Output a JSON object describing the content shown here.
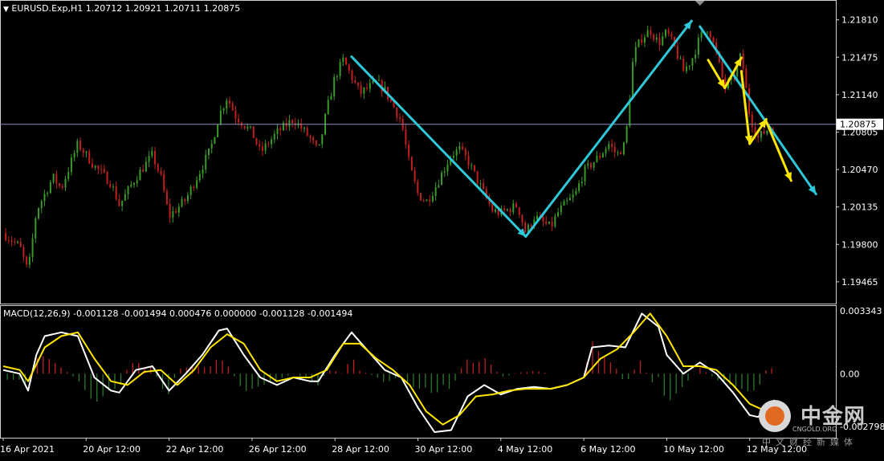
{
  "window": {
    "symbol_info": "EURUSD.Exp,H1  1.20712 1.20921 1.20711 1.20875",
    "macd_info": "MACD(12,26,9) -0.001128 -0.001494 0.000476 0.000000 -0.001128 -0.001494"
  },
  "colors": {
    "background": "#000000",
    "bull": "#3a9a2a",
    "bear": "#c21f1f",
    "current_line": "#8a93b8",
    "cyan_arrows": "#2fc8d8",
    "yellow_arrows": "#ffe600",
    "macd_line": "#ffffff",
    "signal_line": "#ffe600",
    "hist_pos": "#c21f1f",
    "hist_neg": "#2a7a2a"
  },
  "price_axis": {
    "labels": [
      "1.21810",
      "1.21475",
      "1.21140",
      "1.20805",
      "1.20470",
      "1.20135",
      "1.19800",
      "1.19465"
    ],
    "current_label": "1.20875",
    "current_value": 1.20875,
    "range": [
      1.1927,
      1.2198
    ]
  },
  "macd_axis": {
    "labels": [
      "0.003343",
      "0.00",
      "-0.002798"
    ],
    "range": [
      -0.0034,
      0.0036
    ]
  },
  "time_axis": {
    "labels": [
      "16 Apr 2021",
      "20 Apr 12:00",
      "22 Apr 12:00",
      "26 Apr 12:00",
      "28 Apr 12:00",
      "30 Apr 12:00",
      "4 May 12:00",
      "6 May 12:00",
      "10 May 12:00",
      "12 May 12:00"
    ]
  },
  "watermark": {
    "brand_cn": "中金网",
    "brand_en": "CNGOLD.ORG",
    "subtitle_cn": "中文财经新媒体"
  },
  "chart_data": [
    {
      "type": "candlestick",
      "symbol": "EURUSD.Exp",
      "timeframe": "H1",
      "last": {
        "open": 1.20712,
        "high": 1.20921,
        "low": 1.20711,
        "close": 1.20875
      },
      "close_path": [
        {
          "t": 0,
          "v": 1.199
        },
        {
          "t": 2,
          "v": 1.1978
        },
        {
          "t": 3,
          "v": 1.1955
        },
        {
          "t": 4,
          "v": 1.201
        },
        {
          "t": 6,
          "v": 1.204
        },
        {
          "t": 7,
          "v": 1.203
        },
        {
          "t": 9,
          "v": 1.207
        },
        {
          "t": 11,
          "v": 1.205
        },
        {
          "t": 13,
          "v": 1.2035
        },
        {
          "t": 14,
          "v": 1.2015
        },
        {
          "t": 16,
          "v": 1.204
        },
        {
          "t": 18,
          "v": 1.206
        },
        {
          "t": 19,
          "v": 1.204
        },
        {
          "t": 20,
          "v": 1.2005
        },
        {
          "t": 22,
          "v": 1.202
        },
        {
          "t": 23,
          "v": 1.2035
        },
        {
          "t": 25,
          "v": 1.2065
        },
        {
          "t": 26,
          "v": 1.2095
        },
        {
          "t": 27,
          "v": 1.2112
        },
        {
          "t": 28,
          "v": 1.2095
        },
        {
          "t": 30,
          "v": 1.208
        },
        {
          "t": 31,
          "v": 1.2062
        },
        {
          "t": 33,
          "v": 1.208
        },
        {
          "t": 35,
          "v": 1.2092
        },
        {
          "t": 37,
          "v": 1.2075
        },
        {
          "t": 38,
          "v": 1.2062
        },
        {
          "t": 39,
          "v": 1.21
        },
        {
          "t": 40,
          "v": 1.213
        },
        {
          "t": 41,
          "v": 1.2145
        },
        {
          "t": 42,
          "v": 1.213
        },
        {
          "t": 43,
          "v": 1.2115
        },
        {
          "t": 45,
          "v": 1.2125
        },
        {
          "t": 46,
          "v": 1.2118
        },
        {
          "t": 48,
          "v": 1.209
        },
        {
          "t": 49,
          "v": 1.205
        },
        {
          "t": 50,
          "v": 1.2025
        },
        {
          "t": 51,
          "v": 1.2018
        },
        {
          "t": 52,
          "v": 1.203
        },
        {
          "t": 54,
          "v": 1.206
        },
        {
          "t": 55,
          "v": 1.2065
        },
        {
          "t": 56,
          "v": 1.2055
        },
        {
          "t": 57,
          "v": 1.204
        },
        {
          "t": 59,
          "v": 1.201
        },
        {
          "t": 60,
          "v": 1.2008
        },
        {
          "t": 62,
          "v": 1.2015
        },
        {
          "t": 63,
          "v": 1.199
        },
        {
          "t": 64,
          "v": 1.2005
        },
        {
          "t": 65,
          "v": 1.2
        },
        {
          "t": 66,
          "v": 1.1995
        },
        {
          "t": 67,
          "v": 1.201
        },
        {
          "t": 69,
          "v": 1.2025
        },
        {
          "t": 70,
          "v": 1.2045
        },
        {
          "t": 72,
          "v": 1.206
        },
        {
          "t": 73,
          "v": 1.207
        },
        {
          "t": 74,
          "v": 1.206
        },
        {
          "t": 75,
          "v": 1.207
        },
        {
          "t": 76,
          "v": 1.215
        },
        {
          "t": 77,
          "v": 1.2165
        },
        {
          "t": 78,
          "v": 1.2172
        },
        {
          "t": 79,
          "v": 1.216
        },
        {
          "t": 80,
          "v": 1.217
        },
        {
          "t": 81,
          "v": 1.2155
        },
        {
          "t": 82,
          "v": 1.2135
        },
        {
          "t": 83,
          "v": 1.2145
        },
        {
          "t": 84,
          "v": 1.2165
        },
        {
          "t": 85,
          "v": 1.2175
        },
        {
          "t": 86,
          "v": 1.215
        },
        {
          "t": 87,
          "v": 1.212
        },
        {
          "t": 88,
          "v": 1.213
        },
        {
          "t": 89,
          "v": 1.215
        },
        {
          "t": 90,
          "v": 1.2095
        },
        {
          "t": 91,
          "v": 1.2075
        },
        {
          "t": 92,
          "v": 1.2082
        },
        {
          "t": 93,
          "v": 1.20875
        }
      ],
      "arrows_cyan": [
        {
          "from": {
            "t": 42,
            "v": 1.2148
          },
          "to": {
            "t": 63,
            "v": 1.1987
          }
        },
        {
          "from": {
            "t": 63,
            "v": 1.1987
          },
          "to": {
            "t": 83,
            "v": 1.218
          }
        },
        {
          "from": {
            "t": 84,
            "v": 1.2175
          },
          "to": {
            "t": 98,
            "v": 1.2025
          }
        }
      ],
      "arrows_yellow": [
        {
          "from": {
            "t": 85,
            "v": 1.2145
          },
          "to": {
            "t": 87,
            "v": 1.212
          }
        },
        {
          "from": {
            "t": 87,
            "v": 1.212
          },
          "to": {
            "t": 89,
            "v": 1.2147
          }
        },
        {
          "from": {
            "t": 89,
            "v": 1.2135
          },
          "to": {
            "t": 90,
            "v": 1.207
          }
        },
        {
          "from": {
            "t": 90,
            "v": 1.207
          },
          "to": {
            "t": 92,
            "v": 1.2092
          }
        },
        {
          "from": {
            "t": 92,
            "v": 1.209
          },
          "to": {
            "t": 95,
            "v": 1.2037
          }
        }
      ]
    },
    {
      "type": "macd",
      "params": "12,26,9",
      "values": {
        "macd": -0.001128,
        "signal": -0.001494,
        "histogram": 0.000476
      },
      "macd_path": [
        {
          "t": 0,
          "v": 0.0002
        },
        {
          "t": 2,
          "v": 0.0
        },
        {
          "t": 3,
          "v": -0.0009
        },
        {
          "t": 4,
          "v": 0.001
        },
        {
          "t": 5,
          "v": 0.002
        },
        {
          "t": 7,
          "v": 0.0022
        },
        {
          "t": 9,
          "v": 0.002
        },
        {
          "t": 11,
          "v": -0.0002
        },
        {
          "t": 13,
          "v": -0.0009
        },
        {
          "t": 14,
          "v": -0.001
        },
        {
          "t": 16,
          "v": 0.0002
        },
        {
          "t": 18,
          "v": 0.0004
        },
        {
          "t": 20,
          "v": -0.0009
        },
        {
          "t": 22,
          "v": 0.0
        },
        {
          "t": 24,
          "v": 0.001
        },
        {
          "t": 26,
          "v": 0.0023
        },
        {
          "t": 27,
          "v": 0.0024
        },
        {
          "t": 29,
          "v": 0.001
        },
        {
          "t": 31,
          "v": -0.0002
        },
        {
          "t": 33,
          "v": -0.0006
        },
        {
          "t": 35,
          "v": -0.0002
        },
        {
          "t": 37,
          "v": -0.0004
        },
        {
          "t": 38,
          "v": -0.0004
        },
        {
          "t": 40,
          "v": 0.001
        },
        {
          "t": 42,
          "v": 0.0022
        },
        {
          "t": 44,
          "v": 0.0012
        },
        {
          "t": 46,
          "v": 0.0002
        },
        {
          "t": 48,
          "v": -0.0002
        },
        {
          "t": 50,
          "v": -0.0018
        },
        {
          "t": 52,
          "v": -0.0031
        },
        {
          "t": 54,
          "v": -0.003
        },
        {
          "t": 56,
          "v": -0.0012
        },
        {
          "t": 58,
          "v": -0.0006
        },
        {
          "t": 60,
          "v": -0.0011
        },
        {
          "t": 62,
          "v": -0.0008
        },
        {
          "t": 64,
          "v": -0.0007
        },
        {
          "t": 66,
          "v": -0.0008
        },
        {
          "t": 68,
          "v": -0.0006
        },
        {
          "t": 70,
          "v": -0.0002
        },
        {
          "t": 71,
          "v": 0.0014
        },
        {
          "t": 73,
          "v": 0.0015
        },
        {
          "t": 75,
          "v": 0.0014
        },
        {
          "t": 77,
          "v": 0.0032
        },
        {
          "t": 79,
          "v": 0.0025
        },
        {
          "t": 80,
          "v": 0.001
        },
        {
          "t": 82,
          "v": 0.0
        },
        {
          "t": 84,
          "v": 0.0006
        },
        {
          "t": 86,
          "v": 0.0
        },
        {
          "t": 88,
          "v": -0.001
        },
        {
          "t": 90,
          "v": -0.0022
        },
        {
          "t": 91,
          "v": -0.0023
        },
        {
          "t": 93,
          "v": -0.0014
        }
      ],
      "signal_path": [
        {
          "t": 0,
          "v": 0.0004
        },
        {
          "t": 2,
          "v": 0.0002
        },
        {
          "t": 3,
          "v": -0.0004
        },
        {
          "t": 5,
          "v": 0.0014
        },
        {
          "t": 7,
          "v": 0.002
        },
        {
          "t": 9,
          "v": 0.0022
        },
        {
          "t": 11,
          "v": 0.0008
        },
        {
          "t": 13,
          "v": -0.0004
        },
        {
          "t": 15,
          "v": -0.0006
        },
        {
          "t": 17,
          "v": 0.0001
        },
        {
          "t": 19,
          "v": 0.0002
        },
        {
          "t": 21,
          "v": -0.0006
        },
        {
          "t": 23,
          "v": 0.0002
        },
        {
          "t": 25,
          "v": 0.0014
        },
        {
          "t": 27,
          "v": 0.0021
        },
        {
          "t": 29,
          "v": 0.0016
        },
        {
          "t": 31,
          "v": 0.0002
        },
        {
          "t": 33,
          "v": -0.0004
        },
        {
          "t": 35,
          "v": -0.0002
        },
        {
          "t": 37,
          "v": -0.0002
        },
        {
          "t": 39,
          "v": 0.0002
        },
        {
          "t": 41,
          "v": 0.0016
        },
        {
          "t": 43,
          "v": 0.0016
        },
        {
          "t": 45,
          "v": 0.0008
        },
        {
          "t": 47,
          "v": 0.0002
        },
        {
          "t": 49,
          "v": -0.0006
        },
        {
          "t": 51,
          "v": -0.002
        },
        {
          "t": 53,
          "v": -0.0027
        },
        {
          "t": 55,
          "v": -0.0022
        },
        {
          "t": 57,
          "v": -0.0012
        },
        {
          "t": 59,
          "v": -0.0011
        },
        {
          "t": 61,
          "v": -0.0009
        },
        {
          "t": 63,
          "v": -0.0008
        },
        {
          "t": 66,
          "v": -0.0008
        },
        {
          "t": 68,
          "v": -0.0006
        },
        {
          "t": 70,
          "v": -0.0002
        },
        {
          "t": 72,
          "v": 0.0008
        },
        {
          "t": 74,
          "v": 0.0013
        },
        {
          "t": 76,
          "v": 0.0022
        },
        {
          "t": 78,
          "v": 0.0032
        },
        {
          "t": 80,
          "v": 0.002
        },
        {
          "t": 82,
          "v": 0.0004
        },
        {
          "t": 84,
          "v": 0.0004
        },
        {
          "t": 86,
          "v": 0.0002
        },
        {
          "t": 88,
          "v": -0.0006
        },
        {
          "t": 90,
          "v": -0.0016
        },
        {
          "t": 92,
          "v": -0.002
        },
        {
          "t": 93,
          "v": -0.0016
        }
      ]
    }
  ]
}
